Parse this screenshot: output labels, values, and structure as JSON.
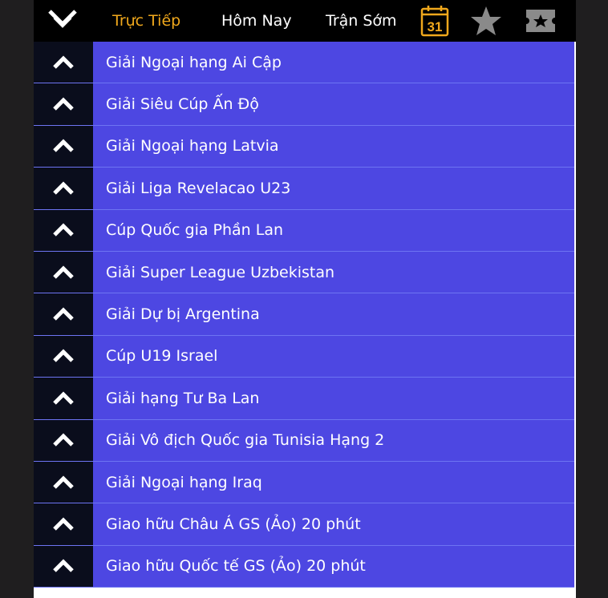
{
  "header": {
    "menu_icon": "double-chevron-down-icon",
    "tabs": [
      {
        "label": "Trực Tiếp",
        "active": true
      },
      {
        "label": "Hôm Nay",
        "active": false
      },
      {
        "label": "Trận Sớm",
        "active": false
      }
    ],
    "calendar_day": "31",
    "icons": [
      "calendar-icon",
      "star-icon",
      "ticket-icon"
    ],
    "colors": {
      "active_tab": "#f0a81c",
      "calendar": "#f0a81c",
      "star": "#8a8a8a"
    }
  },
  "leagues": [
    {
      "label": "Giải Ngoại hạng Ai Cập"
    },
    {
      "label": "Giải Siêu Cúp Ấn Độ"
    },
    {
      "label": "Giải Ngoại hạng Latvia"
    },
    {
      "label": "Giải Liga Revelacao U23"
    },
    {
      "label": "Cúp Quốc gia Phần Lan"
    },
    {
      "label": "Giải Super League Uzbekistan"
    },
    {
      "label": "Giải Dự bị Argentina"
    },
    {
      "label": "Cúp U19 Israel"
    },
    {
      "label": "Giải hạng Tư Ba Lan"
    },
    {
      "label": "Giải Vô địch Quốc gia Tunisia Hạng 2"
    },
    {
      "label": "Giải Ngoại hạng Iraq"
    },
    {
      "label": "Giao hữu Châu Á GS (Ảo) 20 phút"
    },
    {
      "label": "Giao hữu Quốc tế GS (Ảo) 20 phút"
    }
  ],
  "list_colors": {
    "row_bg": "#4d47e2",
    "toggle_bg": "#0a0d1c"
  }
}
